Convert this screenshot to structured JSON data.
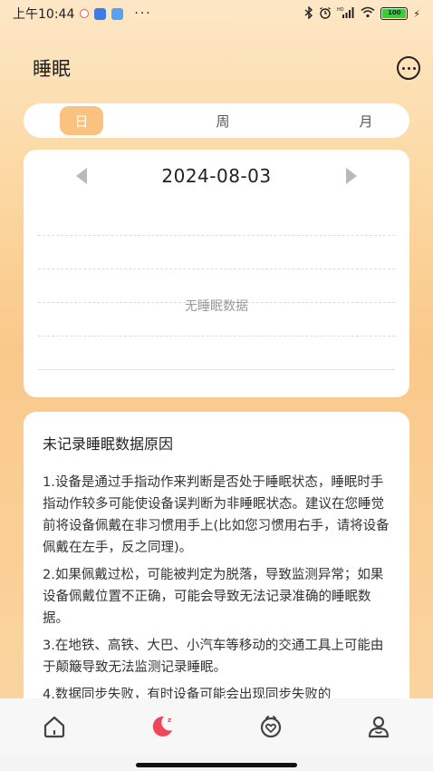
{
  "status_bar": {
    "time": "上午10:44",
    "dots": "···",
    "battery_label": "100",
    "signal_label": "HD"
  },
  "header": {
    "title": "睡眠"
  },
  "segment": {
    "tabs": [
      {
        "label": "日",
        "active": true
      },
      {
        "label": "周",
        "active": false
      },
      {
        "label": "月",
        "active": false
      }
    ]
  },
  "chart_card": {
    "date": "2024-08-03",
    "empty_text": "无睡眠数据"
  },
  "info": {
    "title": "未记录睡眠数据原因",
    "paragraphs": [
      "1.设备是通过手指动作来判断是否处于睡眠状态，睡眠时手指动作较多可能使设备误判断为非睡眠状态。建议在您睡觉前将设备佩戴在非习惯用手上(比如您习惯用右手，请将设备佩戴在左手，反之同理)。",
      "2.如果佩戴过松，可能被判定为脱落，导致监测异常；如果设备佩戴位置不正确，可能会导致无法记录准确的睡眠数据。",
      "3.在地铁、高铁、大巴、小汽车等移动的交通工具上可能由于颠簸导致无法监测记录睡眠。",
      "4.数据同步失败，有时设备可能会出现同步失败的"
    ]
  },
  "tabbar": {
    "items": [
      {
        "icon": "home-icon",
        "active": false
      },
      {
        "icon": "sleep-moon-icon",
        "active": true
      },
      {
        "icon": "health-heart-icon",
        "active": false
      },
      {
        "icon": "profile-icon",
        "active": false
      }
    ]
  },
  "colors": {
    "accent": "#f9c27e",
    "active_tab": "#f0465a",
    "icon_dark": "#444444"
  }
}
